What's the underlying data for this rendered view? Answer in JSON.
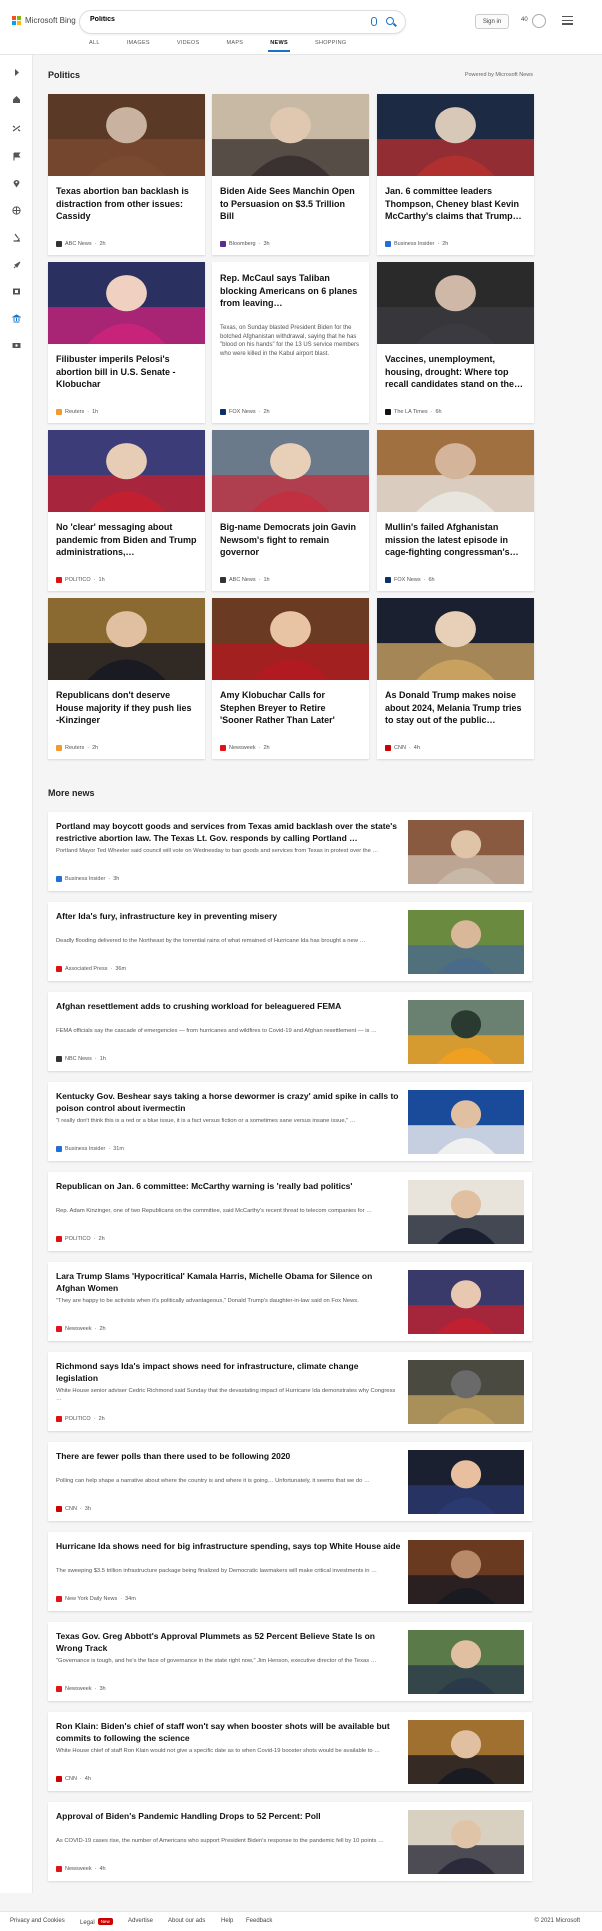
{
  "header": {
    "logo_text": "Microsoft Bing",
    "search_value": "Politics",
    "signin_label": "Sign in",
    "points": "40",
    "tabs": [
      {
        "label": "ALL"
      },
      {
        "label": "IMAGES"
      },
      {
        "label": "VIDEOS"
      },
      {
        "label": "MAPS"
      },
      {
        "label": "NEWS"
      },
      {
        "label": "SHOPPING"
      }
    ],
    "active_tab": "NEWS"
  },
  "colors": {
    "accent": "#1a73c8",
    "logo_red": "#f25022",
    "logo_green": "#7fba00",
    "logo_blue": "#00a4ef",
    "logo_yellow": "#ffb900"
  },
  "sidebar": {
    "icons": [
      "expand-arrow-icon",
      "home-icon",
      "shuffle-icon",
      "flag-icon",
      "map-pin-icon",
      "globe-icon",
      "microscope-icon",
      "rocket-icon",
      "film-icon",
      "bank-icon",
      "money-icon"
    ]
  },
  "politics": {
    "title": "Politics",
    "powered_by": "Powered by Microsoft News",
    "cards": [
      {
        "title": "Texas abortion ban backlash is distraction from other issues: Cassidy",
        "source": "ABC News",
        "time": "2h",
        "icon_color": "#333"
      },
      {
        "title": "Biden Aide Sees Manchin Open to Persuasion on $3.5 Trillion Bill",
        "source": "Bloomberg",
        "time": "3h",
        "icon_color": "#5a2d91"
      },
      {
        "title": "Jan. 6 committee leaders Thompson, Cheney blast Kevin McCarthy's claims that Trump…",
        "source": "Business Insider",
        "time": "2h",
        "icon_color": "#1f6fd6"
      },
      {
        "title": "Filibuster imperils Pelosi's abortion bill in U.S. Senate - Klobuchar",
        "source": "Reuters",
        "time": "1h",
        "icon_color": "#f29a30"
      },
      {
        "title": "Rep. McCaul says Taliban blocking Americans on 6 planes from leaving…",
        "description": "Texas, on Sunday blasted President Biden for the botched Afghanistan withdrawal, saying that he has \"blood on his hands\" for the 13 US service members who were killed in the Kabul airport blast.",
        "source": "FOX News",
        "time": "2h",
        "icon_color": "#0b2f6b"
      },
      {
        "title": "Vaccines, unemployment, housing, drought: Where top recall candidates stand on the…",
        "source": "The LA Times",
        "time": "6h",
        "icon_color": "#111"
      },
      {
        "title": "No 'clear' messaging about pandemic from Biden and Trump administrations,…",
        "source": "POLITICO",
        "time": "1h",
        "icon_color": "#d11"
      },
      {
        "title": "Big-name Democrats join Gavin Newsom's fight to remain governor",
        "source": "ABC News",
        "time": "1h",
        "icon_color": "#333"
      },
      {
        "title": "Mullin's failed Afghanistan mission the latest episode in cage-fighting congressman's…",
        "source": "FOX News",
        "time": "6h",
        "icon_color": "#0b2f6b"
      },
      {
        "title": "Republicans don't deserve House majority if they push lies -Kinzinger",
        "source": "Reuters",
        "time": "2h",
        "icon_color": "#f29a30"
      },
      {
        "title": "Amy Klobuchar Calls for Stephen Breyer to Retire 'Sooner Rather Than Later'",
        "source": "Newsweek",
        "time": "2h",
        "icon_color": "#e0121a"
      },
      {
        "title": "As Donald Trump makes noise about 2024, Melania Trump tries to stay out of the public…",
        "source": "CNN",
        "time": "4h",
        "icon_color": "#cc0000"
      }
    ]
  },
  "more_news": {
    "title": "More news",
    "items": [
      {
        "title": "Portland may boycott goods and services from Texas amid backlash over the state's restrictive abortion law. The Texas Lt. Gov. responds by calling Portland …",
        "description": "Portland Mayor Ted Wheeler said council will vote on Wednesday to ban goods and services from Texas in protest over the …",
        "source": "Business Insider",
        "time": "3h",
        "icon_color": "#1f6fd6"
      },
      {
        "title": "After Ida's fury, infrastructure key in preventing misery",
        "description": "Deadly flooding delivered to the Northeast by the torrential rains of what remained of Hurricane Ida has brought a new …",
        "source": "Associated Press",
        "time": "36m",
        "icon_color": "#d11"
      },
      {
        "title": "Afghan resettlement adds to crushing workload for beleaguered FEMA",
        "description": "FEMA officials say the cascade of emergencies — from hurricanes and wildfires to Covid-19 and Afghan resettlement — is …",
        "source": "NBC News",
        "time": "1h",
        "icon_color": "#333"
      },
      {
        "title": "Kentucky Gov. Beshear says taking a horse dewormer is crazy' amid spike in calls to poison control about ivermectin",
        "description": "\"I really don't think this is a red or a blue issue, it is a fact versus fiction or a sometimes sane versus insane issue,\" …",
        "source": "Business Insider",
        "time": "31m",
        "icon_color": "#1f6fd6"
      },
      {
        "title": "Republican on Jan. 6 committee: McCarthy warning is 'really bad politics'",
        "description": "Rep. Adam Kinzinger, one of two Republicans on the committee, said McCarthy's recent threat to telecom companies for …",
        "source": "POLITICO",
        "time": "2h",
        "icon_color": "#d11"
      },
      {
        "title": "Lara Trump Slams 'Hypocritical' Kamala Harris, Michelle Obama for Silence on Afghan Women",
        "description": "\"They are happy to be activists when it's politically advantageous,\" Donald Trump's daughter-in-law said on Fox News.",
        "source": "Newsweek",
        "time": "2h",
        "icon_color": "#e0121a"
      },
      {
        "title": "Richmond says Ida's impact shows need for infrastructure, climate change legislation",
        "description": "White House senior adviser Cedric Richmond said Sunday that the devastating impact of Hurricane Ida demonstrates why Congress …",
        "source": "POLITICO",
        "time": "2h",
        "icon_color": "#d11"
      },
      {
        "title": "There are fewer polls than there used to be following 2020",
        "description": "Polling can help shape a narrative about where the country is and where it is going… Unfortunately, it seems that we do …",
        "source": "CNN",
        "time": "3h",
        "icon_color": "#cc0000"
      },
      {
        "title": "Hurricane Ida shows need for big infrastructure spending, says top White House aide",
        "description": "The sweeping $3.5 trillion infrastructure package being finalized by Democratic lawmakers will make critical investments in …",
        "source": "New York Daily News",
        "time": "34m",
        "icon_color": "#e0121a"
      },
      {
        "title": "Texas Gov. Greg Abbott's Approval Plummets as 52 Percent Believe State Is on Wrong Track",
        "description": "\"Governance is tough, and he's the face of governance in the state right now,\" Jim Henson, executive director of the Texas …",
        "source": "Newsweek",
        "time": "3h",
        "icon_color": "#e0121a"
      },
      {
        "title": "Ron Klain: Biden's chief of staff won't say when booster shots will be available but commits to following the science",
        "description": "White House chief of staff Ron Klain would not give a specific date as to when Covid-19 booster shots would be available to …",
        "source": "CNN",
        "time": "4h",
        "icon_color": "#cc0000"
      },
      {
        "title": "Approval of Biden's Pandemic Handling Drops to 52 Percent: Poll",
        "description": "As COVID-19 cases rise, the number of Americans who support President Biden's response to the pandemic fell by 10 points …",
        "source": "Newsweek",
        "time": "4h",
        "icon_color": "#e0121a"
      }
    ]
  },
  "footer": {
    "links": [
      "Privacy and Cookies",
      "Legal",
      "Advertise",
      "About our ads",
      "Help",
      "Feedback"
    ],
    "legal_badge": "New",
    "copyright": "© 2021 Microsoft"
  }
}
